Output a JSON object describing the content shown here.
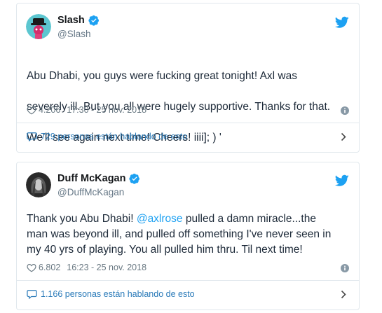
{
  "colors": {
    "accent": "#1da1f2",
    "link": "#2b7bb9",
    "muted": "#657786",
    "border": "#e1e8ed"
  },
  "tweets": [
    {
      "name": "Slash",
      "handle": "@Slash",
      "verified": true,
      "text_lines": [
        "Abu Dhabi, you guys were fucking great tonight! Axl was",
        "severely ill. But you all were hugely supportive. Thanks for that.",
        "We'll see again next time! Cheers! iiii]; ) '"
      ],
      "likes": "4.206",
      "timestamp": "17:30 - 25 nov. 2018",
      "conversation": "729 personas están hablando de esto"
    },
    {
      "name": "Duff McKagan",
      "handle": "@DuffMcKagan",
      "verified": true,
      "text_prefix": "Thank you Abu Dhabi! ",
      "mention": "@axlrose",
      "text_rest": " pulled a damn miracle...the\nman was beyond ill, and pulled off something I've never seen in\nmy 40 yrs of playing. You all pulled him thru. Til next time!",
      "likes": "6.802",
      "timestamp": "16:23 - 25 nov. 2018",
      "conversation": "1.166 personas están hablando de esto"
    }
  ]
}
